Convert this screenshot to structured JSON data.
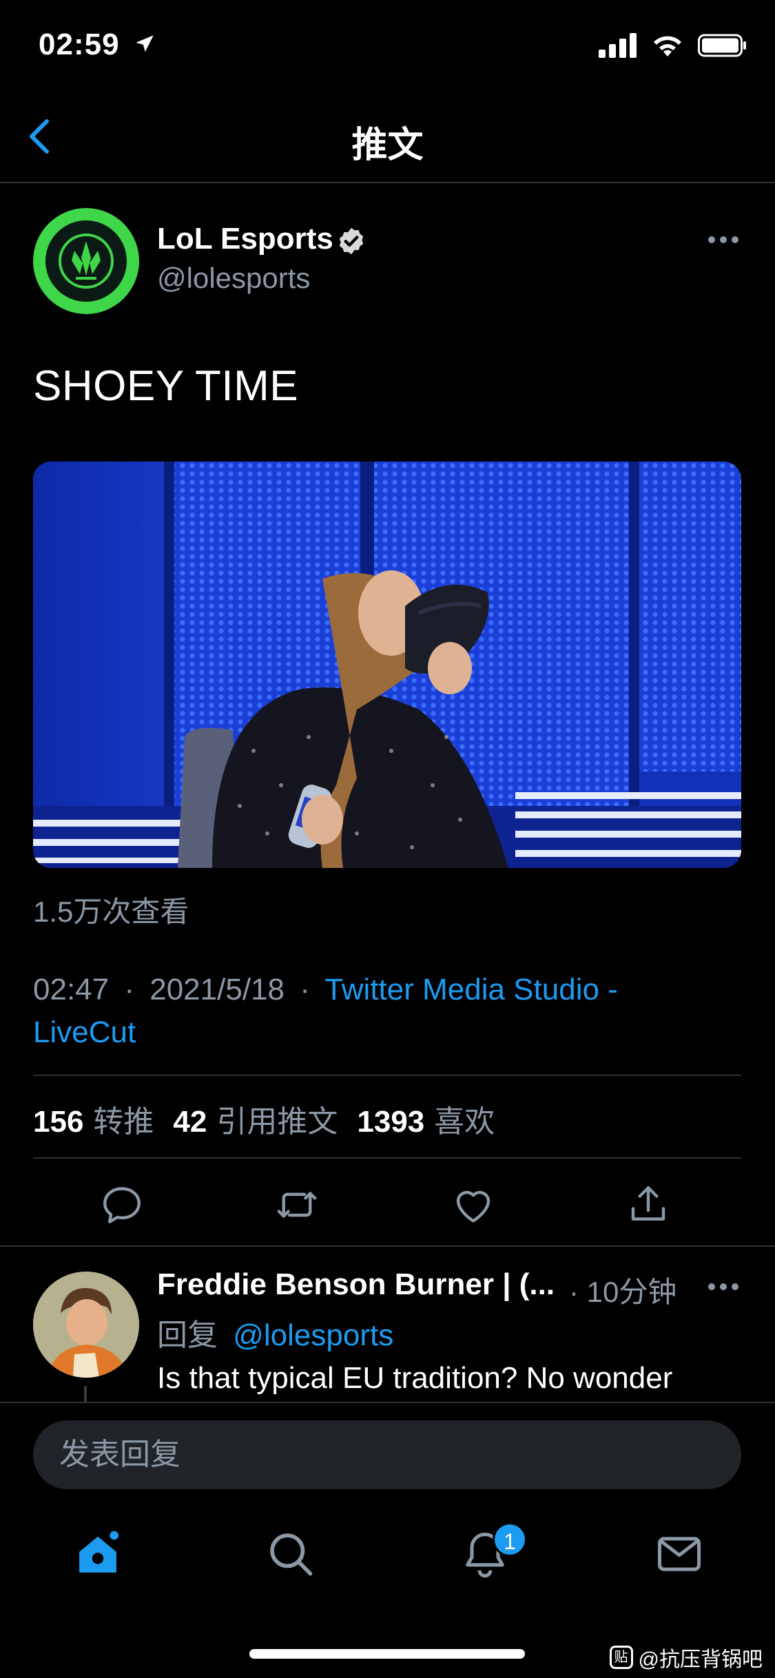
{
  "status_bar": {
    "time": "02:59"
  },
  "header": {
    "title": "推文"
  },
  "tweet": {
    "author_name": "LoL Esports",
    "author_handle": "@lolesports",
    "text": "SHOEY TIME",
    "views": "1.5万次查看",
    "time": "02:47",
    "date": "2021/5/18",
    "source": "Twitter Media Studio - LiveCut",
    "separator": "·"
  },
  "stats": [
    {
      "count": "156",
      "label": "转推"
    },
    {
      "count": "42",
      "label": "引用推文"
    },
    {
      "count": "1393",
      "label": "喜欢"
    }
  ],
  "reply": {
    "author_name": "Freddie Benson Burner | (...",
    "time": "· 10分钟",
    "reply_prefix": "回复",
    "reply_to": "@lolesports",
    "text": "Is that typical EU tradition? No wonder"
  },
  "compose": {
    "placeholder": "发表回复"
  },
  "tabbar": {
    "notification_count": "1"
  },
  "watermark": {
    "text": "@抗压背锅吧",
    "icon_text": "贴"
  },
  "colors": {
    "accent": "#1d9bf0",
    "avatar_green": "#3fd64a",
    "muted": "#8b98a5"
  }
}
